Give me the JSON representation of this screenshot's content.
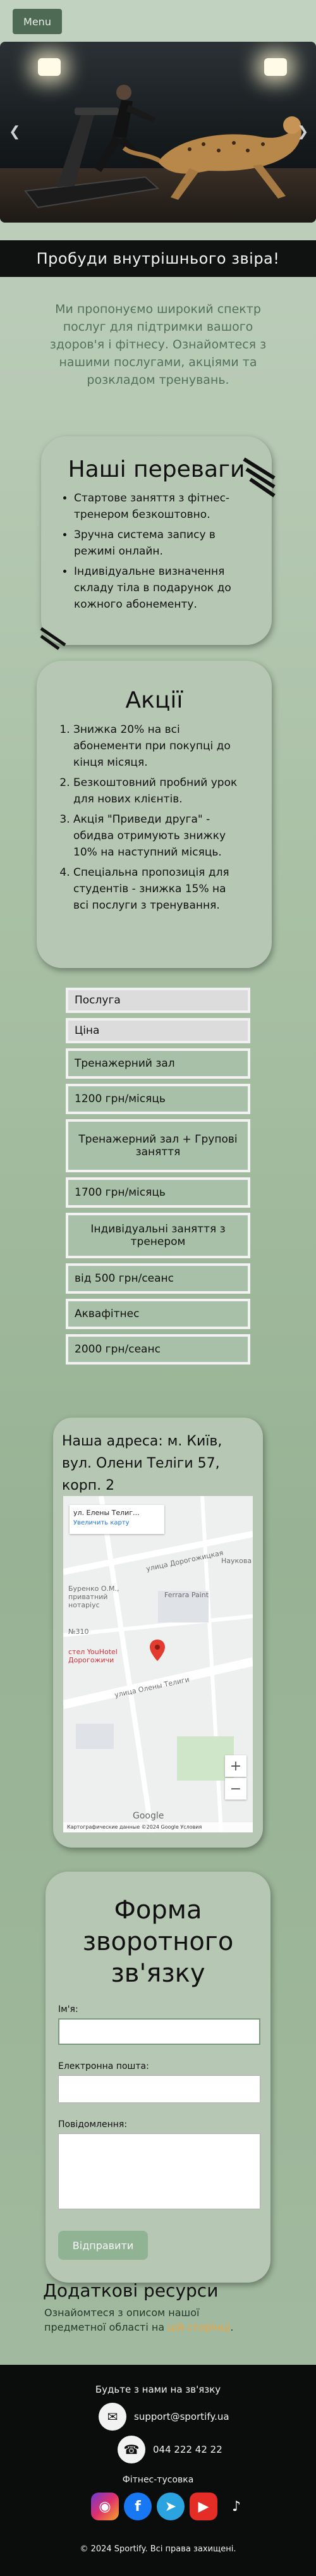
{
  "header": {
    "menu_label": "Menu"
  },
  "hero": {
    "slide_prev_icon": "chevron-left-icon",
    "slide_next_icon": "chevron-right-icon",
    "slide_count": 4,
    "active_slide": 2
  },
  "slogan": "Пробуди внутрішнього звіра!",
  "intro": "Ми пропонуємо широкий спектр послуг для підтримки вашого здоров'я і фітнесу. Ознайомтеся з нашими послугами, акціями та розкладом тренувань.",
  "advantages": {
    "title": "Наші переваги",
    "items": [
      "Стартове заняття з фітнес-тренером безкоштовно.",
      "Зручна система запису в режимі онлайн.",
      "Індивідуальне визначення складу тіла в подарунок до кожного абонементу."
    ]
  },
  "promos": {
    "title": "Акції",
    "items": [
      "Знижка 20% на всі абонементи при покупці до кінця місяця.",
      "Безкоштовний пробний урок для нових клієнтів.",
      "Акція \"Приведи друга\" - обидва отримують знижку 10% на наступний місяць.",
      "Спеціальна пропозиція для студентів - знижка 15% на всі послуги з тренування."
    ]
  },
  "prices": {
    "headers": [
      "Послуга",
      "Ціна"
    ],
    "rows": [
      "Тренажерний зал",
      "1200 грн/місяць",
      "Тренажерний зал + Групові заняття",
      "1700 грн/місяць",
      "Індивідуальні заняття з тренером",
      "від 500 грн/сеанс",
      "Аквафітнес",
      "2000 грн/сеанс"
    ]
  },
  "location": {
    "address": "Наша адреса: м. Київ, вул. Олени Теліги 57, корп. 2",
    "map": {
      "place_name": "ул. Елены Телиг...",
      "enlarge_link": "Увеличить карту",
      "labels": [
        "Буренко О.М., приватний нотаріус",
        "Ferrara Paint",
        "Наукова",
        "№310",
        "стел YouHotel Дорогожичи",
        "улица Олены Телиги",
        "улица Дорогожицкая"
      ],
      "attribution": "Картографические данные ©2024 Google  Условия",
      "logo": "Google"
    }
  },
  "contact_form": {
    "title": "Форма зворотного зв'язку",
    "name_label": "Ім'я:",
    "email_label": "Електронна пошта:",
    "message_label": "Повідомлення:",
    "submit_label": "Відправити"
  },
  "resources": {
    "title": "Додаткові ресурси",
    "text": "Ознайомтеся з описом нашої предметної області на ",
    "link": "цій сторінці",
    "text_end": "."
  },
  "footer": {
    "stay_in_touch": "Будьте з нами на зв'язку",
    "email": "support@sportify.ua",
    "phone": "044 222 42 22",
    "community": "Фітнес-тусовка",
    "socials": [
      "instagram-icon",
      "facebook-icon",
      "telegram-icon",
      "youtube-icon",
      "tiktok-icon"
    ],
    "copyright": "© 2024 Sportify. Всі права захищені."
  }
}
